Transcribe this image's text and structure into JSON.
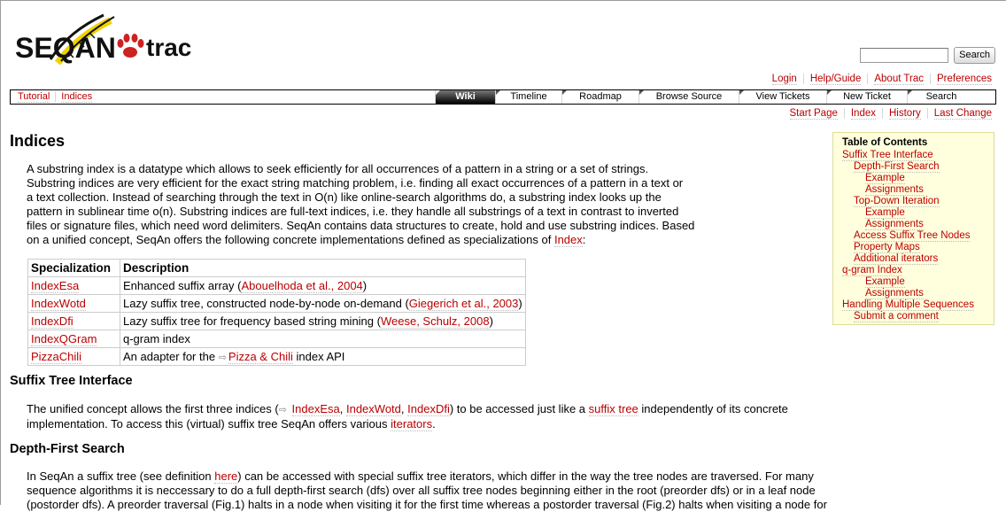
{
  "logo": {
    "text_seqan": "SEQAN",
    "text_trac": "trac"
  },
  "search": {
    "button": "Search"
  },
  "metanav": [
    "Login",
    "Help/Guide",
    "About Trac",
    "Preferences"
  ],
  "context_left": [
    "Tutorial",
    "Indices"
  ],
  "mainnav": [
    {
      "label": "Wiki",
      "active": true
    },
    {
      "label": "Timeline"
    },
    {
      "label": "Roadmap"
    },
    {
      "label": "Browse Source"
    },
    {
      "label": "View Tickets"
    },
    {
      "label": "New Ticket"
    },
    {
      "label": "Search"
    }
  ],
  "ctxnav": [
    "Start Page",
    "Index",
    "History",
    "Last Change"
  ],
  "page": {
    "title": "Indices",
    "intro_lines": [
      "A substring index is a datatype which allows to seek efficiently for all occurrences of a pattern in a string or a set of strings.",
      "Substring indices are very efficient for the exact string matching problem, i.e. finding all exact occurrences of a pattern in a text or",
      "a text collection. Instead of searching through the text in O(n) like online-search algorithms do, a substring index looks up the",
      "pattern in sublinear time o(n). Substring indices are full-text indices, i.e. they handle all substrings of a text in contrast to inverted",
      "files or signature files, which need word delimiters. SeqAn contains data structures to create, hold and use substring indices. Based",
      "on a unified concept, SeqAn offers the following concrete implementations defined as specializations of "
    ],
    "intro_link": "Index",
    "intro_end": ":"
  },
  "table": {
    "headers": [
      "Specialization",
      "Description"
    ],
    "rows": [
      {
        "spec": "IndexEsa",
        "desc": "Enhanced suffix array (",
        "link": "Abouelhoda et al., 2004",
        "end": ")",
        "ext": false
      },
      {
        "spec": "IndexWotd",
        "desc": "Lazy suffix tree, constructed node-by-node on-demand (",
        "link": "Giegerich et al., 2003",
        "end": ")",
        "ext": false
      },
      {
        "spec": "IndexDfi",
        "desc": "Lazy suffix tree for frequency based string mining (",
        "link": "Weese, Schulz, 2008",
        "end": ")",
        "ext": false
      },
      {
        "spec": "IndexQGram",
        "desc": "q-gram index",
        "link": "",
        "end": "",
        "ext": false
      },
      {
        "spec": "PizzaChili",
        "desc": "An adapter for the ",
        "link": "Pizza & Chili",
        "end": " index API",
        "ext": true
      }
    ]
  },
  "section1": {
    "title": "Suffix Tree Interface",
    "line1_a": "The unified concept allows the first three indices (",
    "line1_links": [
      "IndexEsa",
      "IndexWotd",
      "IndexDfi"
    ],
    "line1_b": ") to be accessed just like a ",
    "line1_link2": "suffix tree",
    "line1_c": " independently of its concrete",
    "line2_a": "implementation. To access this (virtual) suffix tree SeqAn offers various ",
    "line2_link": "iterators",
    "line2_b": "."
  },
  "section2": {
    "title": "Depth-First Search",
    "line1_a": "In SeqAn a suffix tree (see definition ",
    "line1_link": "here",
    "line1_b": ") can be accessed with special suffix tree iterators, which differ in the way the tree nodes are traversed. For many",
    "line2": "sequence algorithms it is neccessary to do a full depth-first search (dfs) over all suffix tree nodes beginning either in the root (preorder dfs) or in a leaf node",
    "line3": "(postorder dfs). A preorder traversal (Fig.1) halts in a node when visiting it for the first time whereas a postorder traversal (Fig.2) halts when visiting a node for"
  },
  "toc": {
    "title": "Table of Contents",
    "items": [
      {
        "label": "Suffix Tree Interface",
        "level": 1
      },
      {
        "label": "Depth-First Search",
        "level": 2
      },
      {
        "label": "Example",
        "level": 3
      },
      {
        "label": "Assignments",
        "level": 3
      },
      {
        "label": "Top-Down Iteration",
        "level": 2
      },
      {
        "label": "Example",
        "level": 3
      },
      {
        "label": "Assignments",
        "level": 3
      },
      {
        "label": "Access Suffix Tree Nodes",
        "level": 2
      },
      {
        "label": "Property Maps",
        "level": 2
      },
      {
        "label": "Additional iterators",
        "level": 2
      },
      {
        "label": "q-gram Index",
        "level": 1
      },
      {
        "label": "Example",
        "level": 3
      },
      {
        "label": "Assignments",
        "level": 3
      },
      {
        "label": "Handling Multiple Sequences",
        "level": 1
      },
      {
        "label": "Submit a comment",
        "level": 2
      }
    ]
  },
  "colors": {
    "link": "#bb0000",
    "toc_bg": "#ffffdd",
    "logo_red": "#cc2222",
    "logo_yellow": "#f2d200"
  }
}
